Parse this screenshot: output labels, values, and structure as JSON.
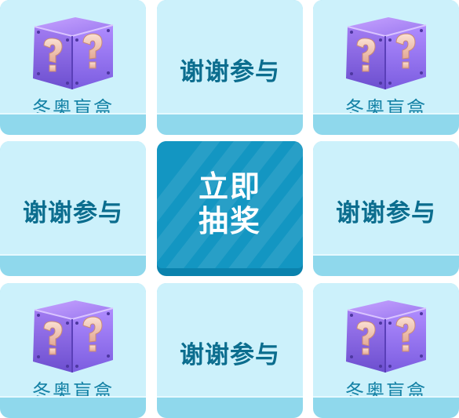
{
  "grid": {
    "top_left": {
      "type": "prize",
      "label": "冬奥盲盒",
      "icon": "mystery-box-icon"
    },
    "top_center": {
      "type": "thanks",
      "label": "谢谢参与"
    },
    "top_right": {
      "type": "prize",
      "label": "冬奥盲盒",
      "icon": "mystery-box-icon"
    },
    "middle_left": {
      "type": "thanks",
      "label": "谢谢参与"
    },
    "center_button": {
      "line1": "立即",
      "line2": "抽奖"
    },
    "middle_right": {
      "type": "thanks",
      "label": "谢谢参与"
    },
    "bottom_left": {
      "type": "prize",
      "label": "冬奥盲盒",
      "icon": "mystery-box-icon"
    },
    "bottom_center": {
      "type": "thanks",
      "label": "谢谢参与"
    },
    "bottom_right": {
      "type": "prize",
      "label": "冬奥盲盒",
      "icon": "mystery-box-icon"
    }
  },
  "colors": {
    "tile_face": "#ccf1fb",
    "tile_base": "#8fd8ec",
    "text": "#0b6d8e",
    "button": "#1396c2",
    "button_text": "#ffffff",
    "box_purple": "#8d6ee6",
    "question_mark": "#f3c9b8"
  }
}
